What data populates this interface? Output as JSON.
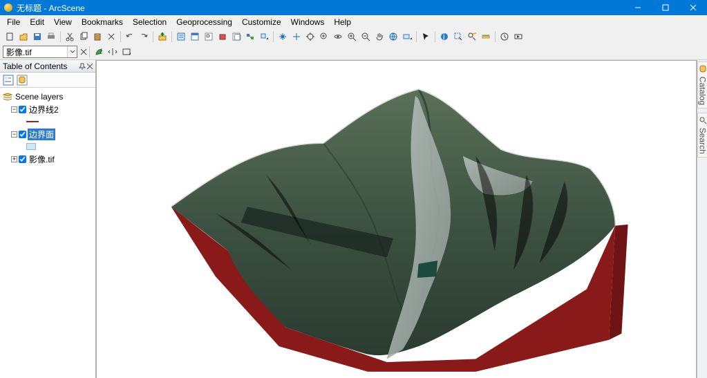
{
  "title": "无标题 - ArcScene",
  "menus": [
    "File",
    "Edit",
    "View",
    "Bookmarks",
    "Selection",
    "Geoprocessing",
    "Customize",
    "Windows",
    "Help"
  ],
  "layer_combo_value": "影像.tif",
  "toc": {
    "title": "Table of Contents",
    "root": "Scene layers",
    "layers": [
      {
        "name": "边界线2",
        "checked": true,
        "selected": false
      },
      {
        "name": "边界面",
        "checked": true,
        "selected": true
      },
      {
        "name": "影像.tif",
        "checked": true,
        "selected": false
      }
    ]
  },
  "right_tabs": [
    "Catalog",
    "Search"
  ]
}
